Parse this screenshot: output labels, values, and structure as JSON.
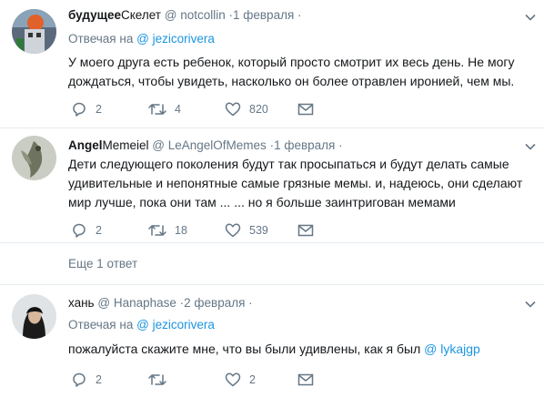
{
  "tweets": [
    {
      "name": "будущее",
      "extra": "Скелет",
      "handle": "@ notcollin",
      "date": "·1 февраля ·",
      "reply_prefix": "Отвечая на",
      "reply_handle": "@ jezicorivera",
      "text": "У моего друга есть ребенок, который просто смотрит их весь день. Не могу дождаться, чтобы увидеть, насколько он более отравлен иронией, чем мы.",
      "replies": "2",
      "retweets": "4",
      "likes": "820"
    },
    {
      "name": "Angel",
      "extra": "Memeiel",
      "handle": "@ LeAngelOfMemes",
      "date": "·1 февраля ·",
      "text": "Дети следующего поколения будут так просыпаться и будут делать самые удивительные и непонятные самые грязные мемы. и, надеюсь, они сделают мир лучше, пока они там ... ... но я больше заинтригован мемами",
      "replies": "2",
      "retweets": "18",
      "likes": "539"
    },
    {
      "name": "хань",
      "handle": "@ Hanaphase",
      "date": "·2 февраля ·",
      "reply_prefix": "Отвечая на",
      "reply_handle": "@ jezicorivera",
      "text_main": "пожалуйста скажите мне, что вы были удивлены, как я был",
      "text_mention": "@ lykajgp",
      "replies": "2",
      "retweets": "",
      "likes": "2"
    }
  ],
  "more_replies": "Еще 1 ответ",
  "icons": {
    "reply": "reply-icon",
    "retweet": "retweet-icon",
    "like": "heart-icon",
    "dm": "envelope-icon",
    "menu": "chevron-down-icon"
  },
  "colors": {
    "accent": "#1b95e0",
    "muted": "#657786",
    "text": "#14171a",
    "divider": "#e6ecf0"
  }
}
